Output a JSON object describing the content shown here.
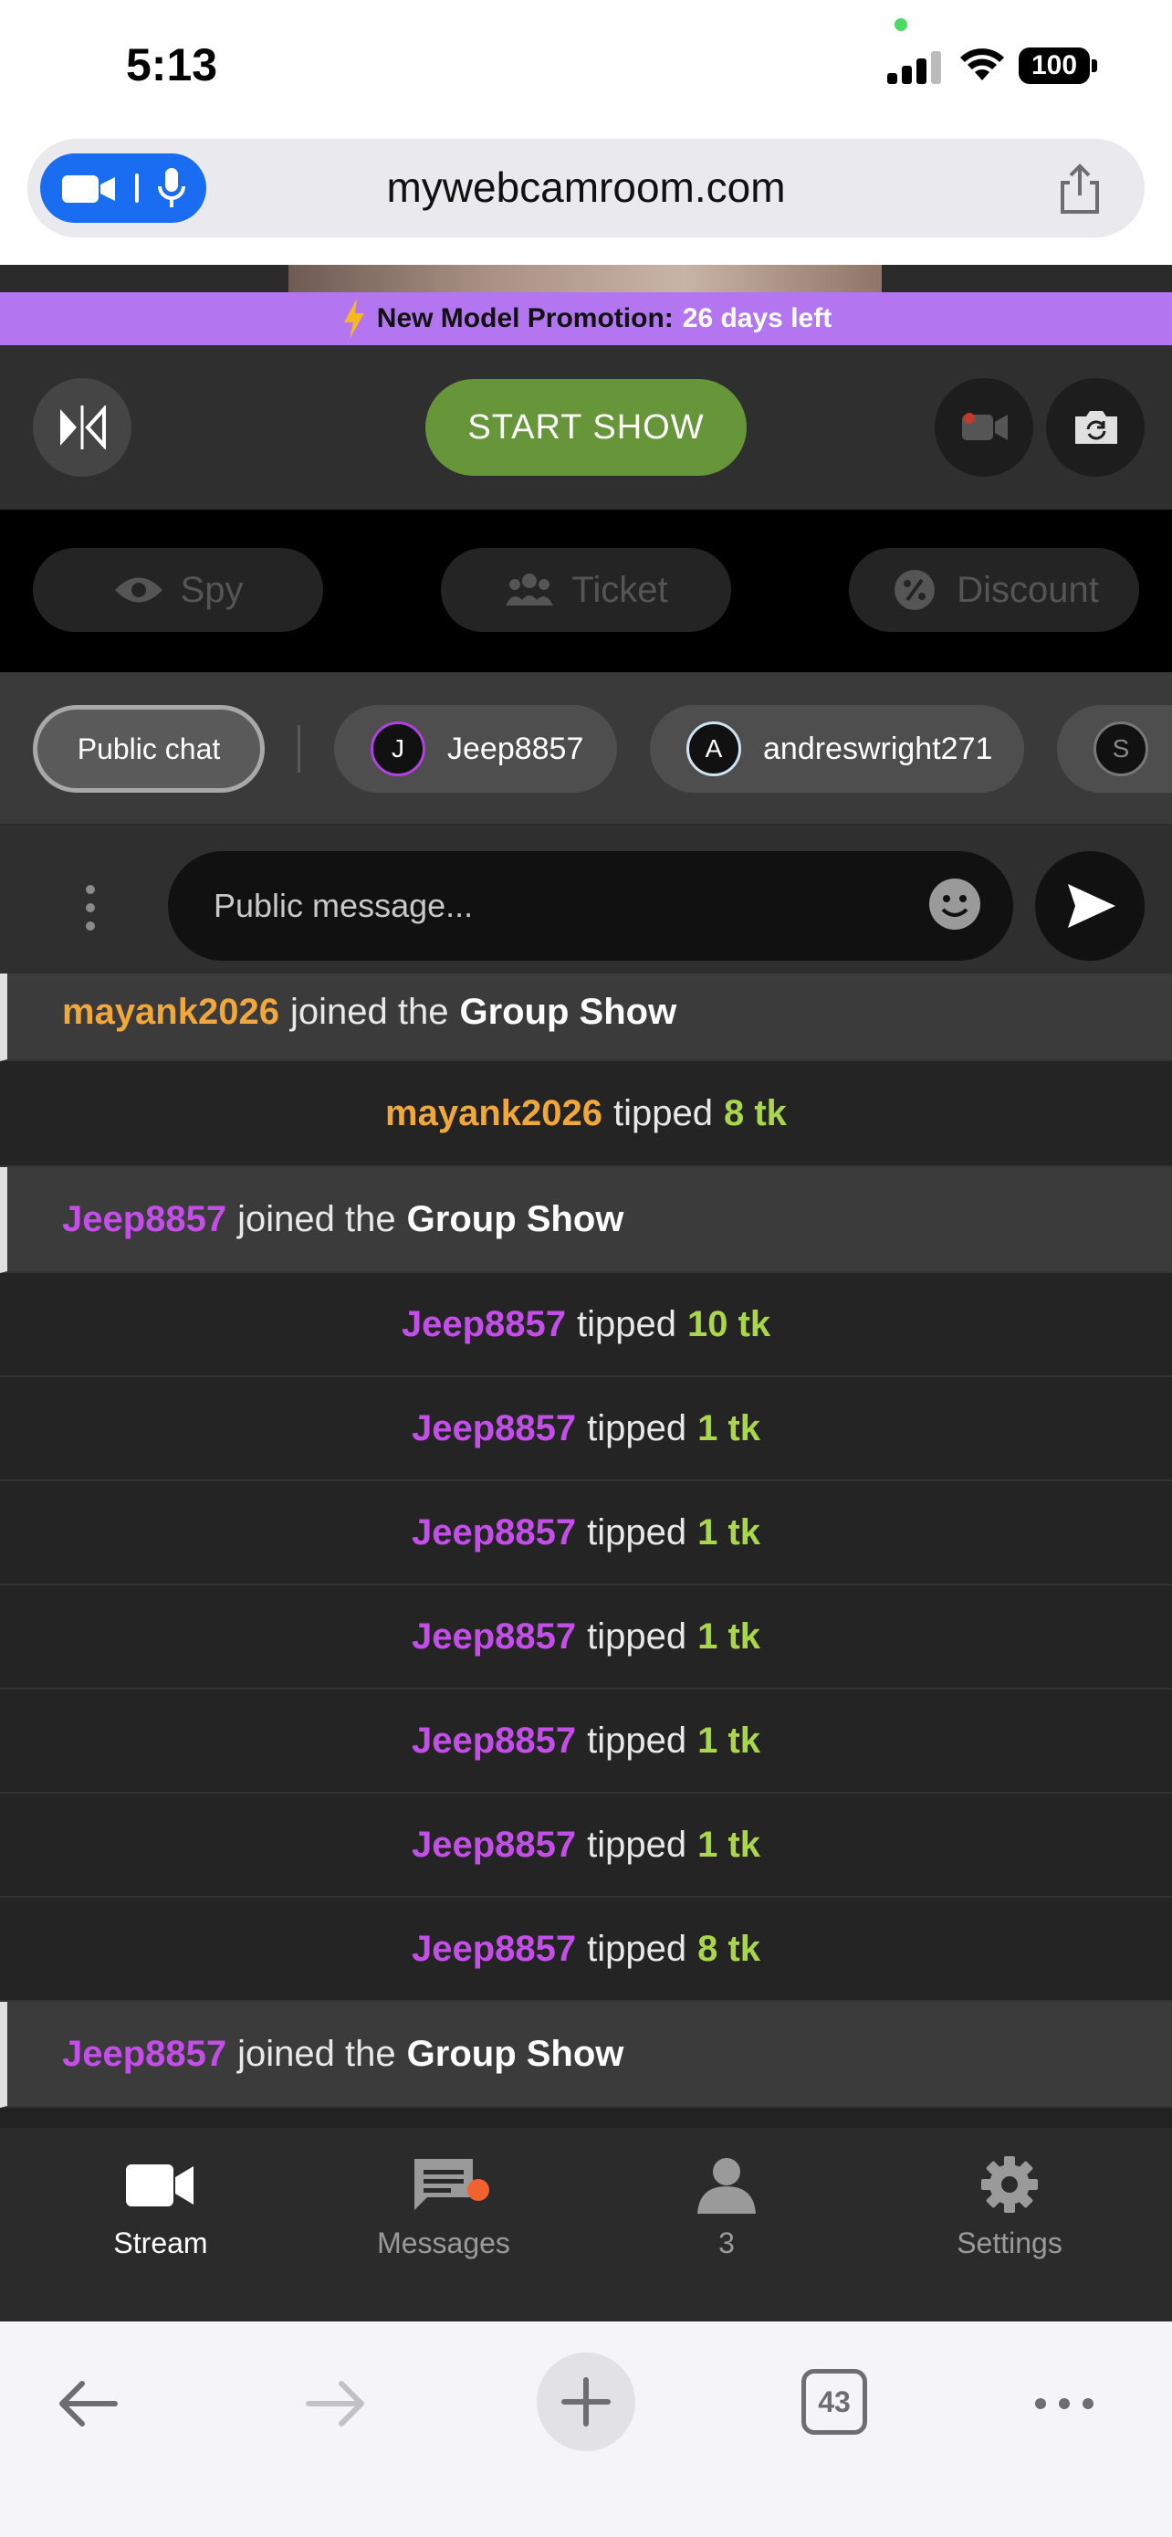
{
  "status_bar": {
    "time": "5:13",
    "battery": "100"
  },
  "browser": {
    "url": "mywebcamroom.com",
    "tab_count": "43"
  },
  "promo": {
    "label": "New Model Promotion:",
    "days_left": "26 days left"
  },
  "controls": {
    "start_label": "START SHOW"
  },
  "modes": [
    {
      "label": "Spy",
      "icon": "eye-icon"
    },
    {
      "label": "Ticket",
      "icon": "users-icon"
    },
    {
      "label": "Discount",
      "icon": "percent-badge-icon"
    }
  ],
  "chat_tabs": {
    "public_label": "Public chat",
    "users": [
      {
        "initial": "J",
        "name": "Jeep8857"
      },
      {
        "initial": "A",
        "name": "andreswright271"
      },
      {
        "initial": "S",
        "name": ""
      }
    ]
  },
  "composer": {
    "placeholder": "Public message..."
  },
  "messages": [
    {
      "type": "join",
      "user": "mayank2026",
      "user_color": "#f0a73c",
      "action": "joined the",
      "target": "Group Show"
    },
    {
      "type": "tip",
      "user": "mayank2026",
      "user_color": "#f0a73c",
      "action": "tipped",
      "amount": "8 tk"
    },
    {
      "type": "join",
      "user": "Jeep8857",
      "user_color": "#c34ee8",
      "action": "joined the",
      "target": "Group Show"
    },
    {
      "type": "tip",
      "user": "Jeep8857",
      "user_color": "#c34ee8",
      "action": "tipped",
      "amount": "10 tk"
    },
    {
      "type": "tip",
      "user": "Jeep8857",
      "user_color": "#c34ee8",
      "action": "tipped",
      "amount": "1 tk"
    },
    {
      "type": "tip",
      "user": "Jeep8857",
      "user_color": "#c34ee8",
      "action": "tipped",
      "amount": "1 tk"
    },
    {
      "type": "tip",
      "user": "Jeep8857",
      "user_color": "#c34ee8",
      "action": "tipped",
      "amount": "1 tk"
    },
    {
      "type": "tip",
      "user": "Jeep8857",
      "user_color": "#c34ee8",
      "action": "tipped",
      "amount": "1 tk"
    },
    {
      "type": "tip",
      "user": "Jeep8857",
      "user_color": "#c34ee8",
      "action": "tipped",
      "amount": "1 tk"
    },
    {
      "type": "tip",
      "user": "Jeep8857",
      "user_color": "#c34ee8",
      "action": "tipped",
      "amount": "8 tk"
    },
    {
      "type": "join",
      "user": "Jeep8857",
      "user_color": "#c34ee8",
      "action": "joined the",
      "target": "Group Show"
    }
  ],
  "app_nav": [
    {
      "label": "Stream",
      "icon": "video-camera-icon",
      "active": true
    },
    {
      "label": "Messages",
      "icon": "chat-bubble-icon",
      "active": false
    },
    {
      "label": "3",
      "icon": "person-icon",
      "active": false
    },
    {
      "label": "Settings",
      "icon": "gear-icon",
      "active": false
    }
  ],
  "colors": {
    "accent_green": "#67953a",
    "promo_purple": "#b476f0",
    "tip_green": "#a9d64a",
    "notification": "#f2622f"
  }
}
